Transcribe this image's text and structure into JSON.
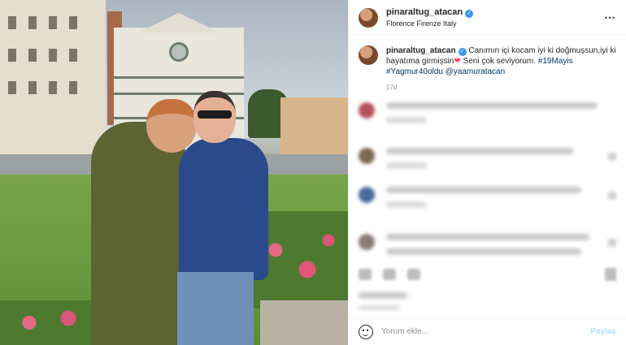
{
  "post": {
    "username": "pinaraltug_atacan",
    "location": "Florence Firenze Italy",
    "more_icon": "⋯",
    "caption": {
      "username": "pinaraltug_atacan",
      "text": "Canımın içi kocam iyi ki doğmuşsun,iyi ki hayatıma girmişsin",
      "heart": "❤",
      "text2": " Seni çok seviyorum.",
      "hashtag1": "#19Mayis",
      "hashtag2": "#Yagmur40oldu",
      "mention": "@yaamuratacan",
      "age": "17d"
    }
  },
  "comment_box": {
    "placeholder": "Yorum ekle...",
    "share_label": "Paylaş"
  },
  "colors": {
    "link": "#00376b",
    "verified": "#3897f0",
    "share": "#b2dffc"
  }
}
